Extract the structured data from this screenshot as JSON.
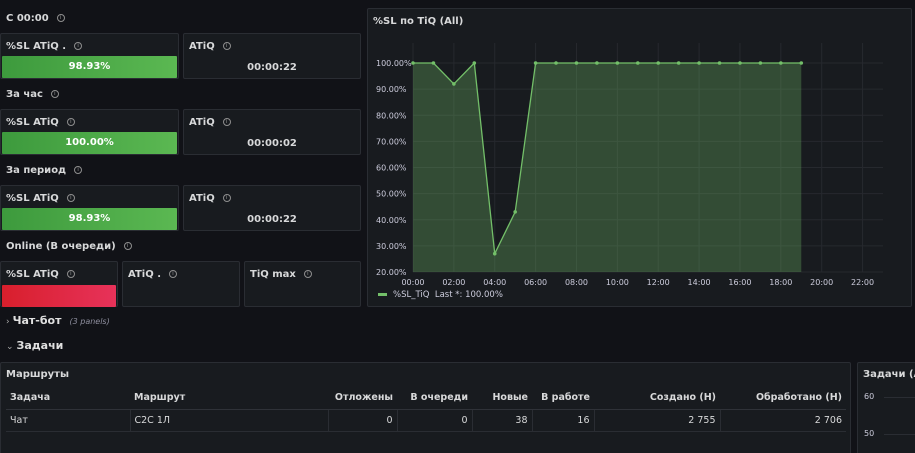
{
  "sections": {
    "s1": "С 00:00",
    "s2": "За час",
    "s3": "За период",
    "s4": "Online (В очереди)"
  },
  "panels": {
    "p1": {
      "title": "%SL ATiQ .",
      "value": "98.93%"
    },
    "p2": {
      "title": "ATiQ",
      "value": "00:00:22"
    },
    "p3": {
      "title": "%SL ATiQ",
      "value": "100.00%"
    },
    "p4": {
      "title": "ATiQ",
      "value": "00:00:02"
    },
    "p5": {
      "title": "%SL ATiQ",
      "value": "98.93%"
    },
    "p6": {
      "title": "ATiQ",
      "value": "00:00:22"
    },
    "p7": {
      "title": "%SL ATiQ",
      "value": ""
    },
    "p8": {
      "title": "ATiQ .",
      "value": ""
    },
    "p9": {
      "title": "TiQ max",
      "value": ""
    }
  },
  "chart_panel": {
    "title": "%SL по TiQ (All)",
    "legend_label": "%SL_TiQ",
    "legend_last": "Last *: 100.00%"
  },
  "chart_data": {
    "type": "area",
    "title": "%SL по TiQ (All)",
    "x": [
      "00:00",
      "01:00",
      "02:00",
      "03:00",
      "04:00",
      "05:00",
      "06:00",
      "07:00",
      "08:00",
      "09:00",
      "10:00",
      "11:00",
      "12:00",
      "13:00",
      "14:00",
      "15:00",
      "16:00",
      "17:00",
      "18:00",
      "19:00"
    ],
    "series": [
      {
        "name": "%SL_TiQ",
        "values": [
          100,
          100,
          92,
          100,
          27,
          43,
          100,
          100,
          100,
          100,
          100,
          100,
          100,
          100,
          100,
          100,
          100,
          100,
          100,
          100
        ]
      }
    ],
    "xticks": [
      "00:00",
      "02:00",
      "04:00",
      "06:00",
      "08:00",
      "10:00",
      "12:00",
      "14:00",
      "16:00",
      "18:00",
      "20:00",
      "22:00"
    ],
    "yticks": [
      "100.00%",
      "90.00%",
      "80.00%",
      "70.00%",
      "60.00%",
      "50.00%",
      "40.00%",
      "30.00%",
      "20.00%"
    ],
    "ylim": [
      20,
      100
    ],
    "xlim": [
      "00:00",
      "23:00"
    ],
    "color": "#73bf69"
  },
  "rows": {
    "chatbot": {
      "label": "Чат-бот",
      "meta": "(3 panels)"
    },
    "tasks": {
      "label": "Задачи"
    }
  },
  "routes": {
    "title": "Маршруты",
    "columns": [
      "Задача",
      "Маршрут",
      "Отложены",
      "В очереди",
      "Новые",
      "В работе",
      "Создано (Н)",
      "Обработано (Н)"
    ],
    "rows": [
      [
        "Чат",
        "C2C 1Л",
        "0",
        "0",
        "38",
        "16",
        "2 755",
        "2 706"
      ]
    ]
  },
  "tasks_panel": {
    "title": "Задачи (All",
    "yticks": [
      "60",
      "50"
    ]
  }
}
